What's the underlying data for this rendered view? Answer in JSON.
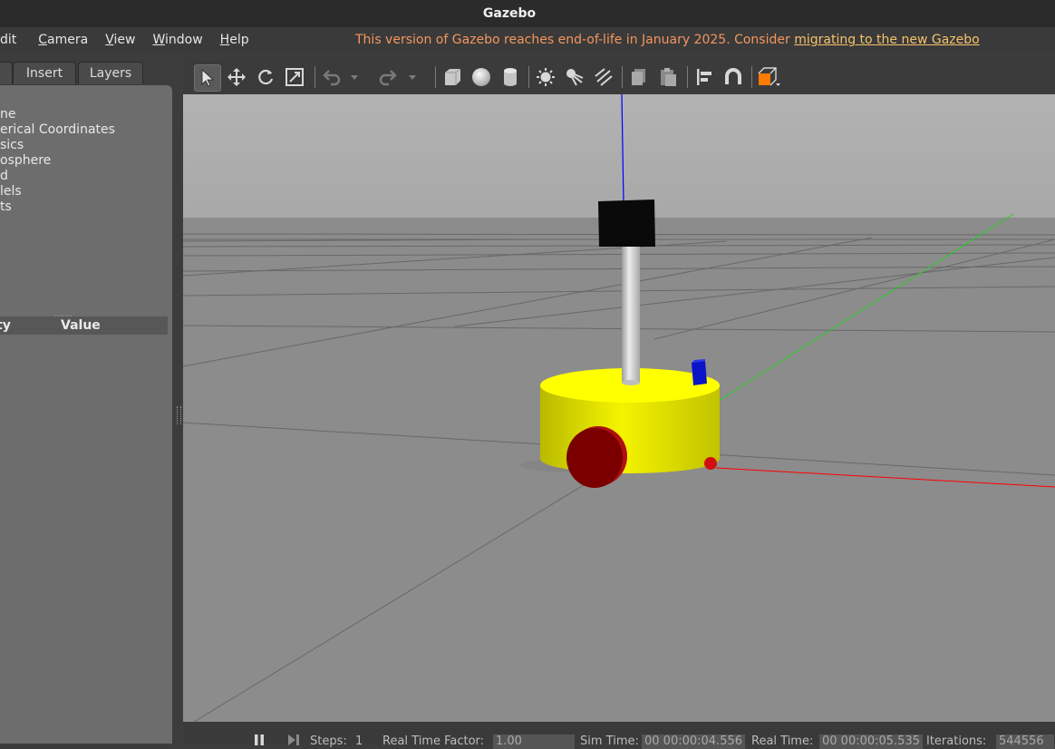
{
  "window": {
    "title": "Gazebo"
  },
  "menu": {
    "items": [
      {
        "pre": "",
        "u": "",
        "post": "dit"
      },
      {
        "pre": "",
        "u": "C",
        "post": "amera"
      },
      {
        "pre": "",
        "u": "V",
        "post": "iew"
      },
      {
        "pre": "",
        "u": "W",
        "post": "indow"
      },
      {
        "pre": "",
        "u": "H",
        "post": "elp"
      }
    ],
    "eol_notice": "This version of Gazebo reaches end-of-life in January 2025. Consider ",
    "eol_link": "migrating to the new Gazebo"
  },
  "left_panel": {
    "tabs": [
      "Insert",
      "Layers"
    ],
    "tree_items": [
      "ne",
      "erical Coordinates",
      "sics",
      "osphere",
      "d",
      "lels",
      "ts"
    ],
    "property_header": {
      "col1": "ty",
      "col2": "Value"
    }
  },
  "bottom_bar": {
    "steps_label": "Steps:",
    "steps_value": "1",
    "rtf_label": "Real Time Factor:",
    "rtf_value": "1.00",
    "sim_label": "Sim Time:",
    "sim_value": "00 00:00:04.556",
    "real_label": "Real Time:",
    "real_value": "00 00:00:05.535",
    "iter_label": "Iterations:",
    "iter_value": "544556"
  },
  "colors": {
    "eol_text": "#f3965f",
    "eol_link": "#f5c26b",
    "robot_body": "#ffff00",
    "wheel": "#8b0000",
    "x_axis": "#ff0000",
    "y_axis": "#00c000",
    "z_axis": "#0000ff"
  },
  "icons": [
    "select-arrow-icon",
    "translate-icon",
    "rotate-icon",
    "scale-icon",
    "undo-icon",
    "redo-icon",
    "box-icon",
    "sphere-icon",
    "cylinder-icon",
    "point-light-icon",
    "spot-light-icon",
    "directional-light-icon",
    "copy-icon",
    "paste-icon",
    "align-icon",
    "snap-magnet-icon",
    "view-angle-icon"
  ]
}
